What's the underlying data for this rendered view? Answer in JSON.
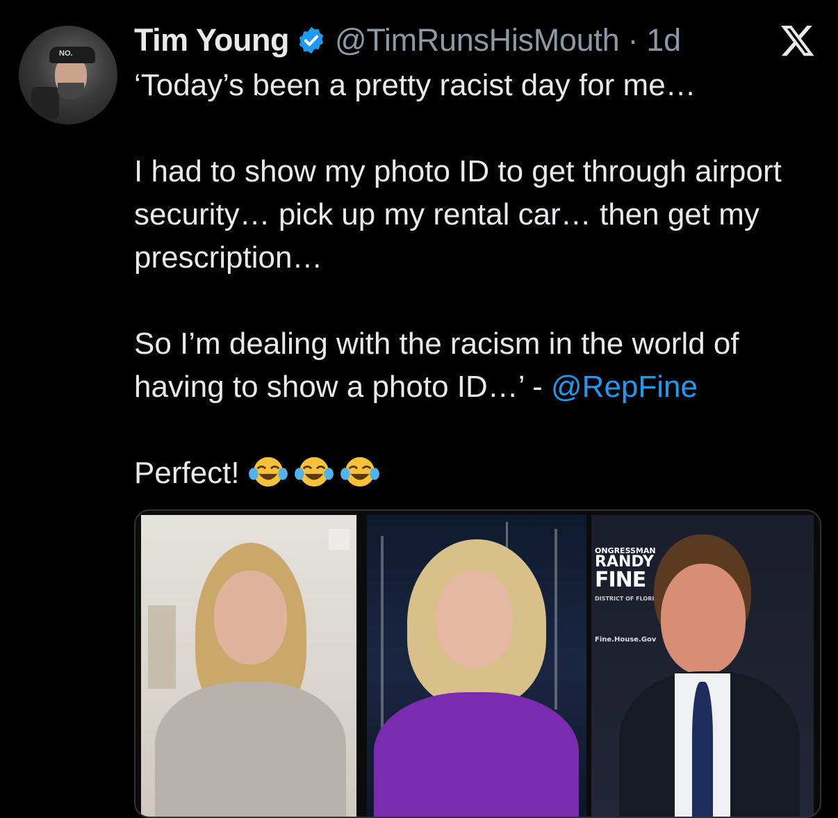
{
  "tweet": {
    "author_name": "Tim Young",
    "handle_and_time": "@TimRunsHisMouth · 1d",
    "avatar_text": "NO.",
    "lines": [
      "‘Today’s been a pretty racist day for me…",
      "I had to show my photo ID to get through airport security… pick up my rental car… then get my prescription…",
      "So I’m dealing with the racism in the world of having to show a photo ID…’ - "
    ],
    "mention": "@RepFine",
    "closing": "Perfect!",
    "emoji_count": 3
  },
  "media": {
    "banner": {
      "line1": "ONGRESSMAN",
      "line2": "RANDY",
      "line3": "FINE",
      "line4": "DISTRICT OF FLORIDA",
      "line5": "Fine.House.Gov"
    }
  },
  "colors": {
    "background": "#000000",
    "text": "#e7e9ea",
    "secondary": "#8b98a5",
    "link": "#1d9bf0",
    "verified": "#1d9bf0"
  }
}
